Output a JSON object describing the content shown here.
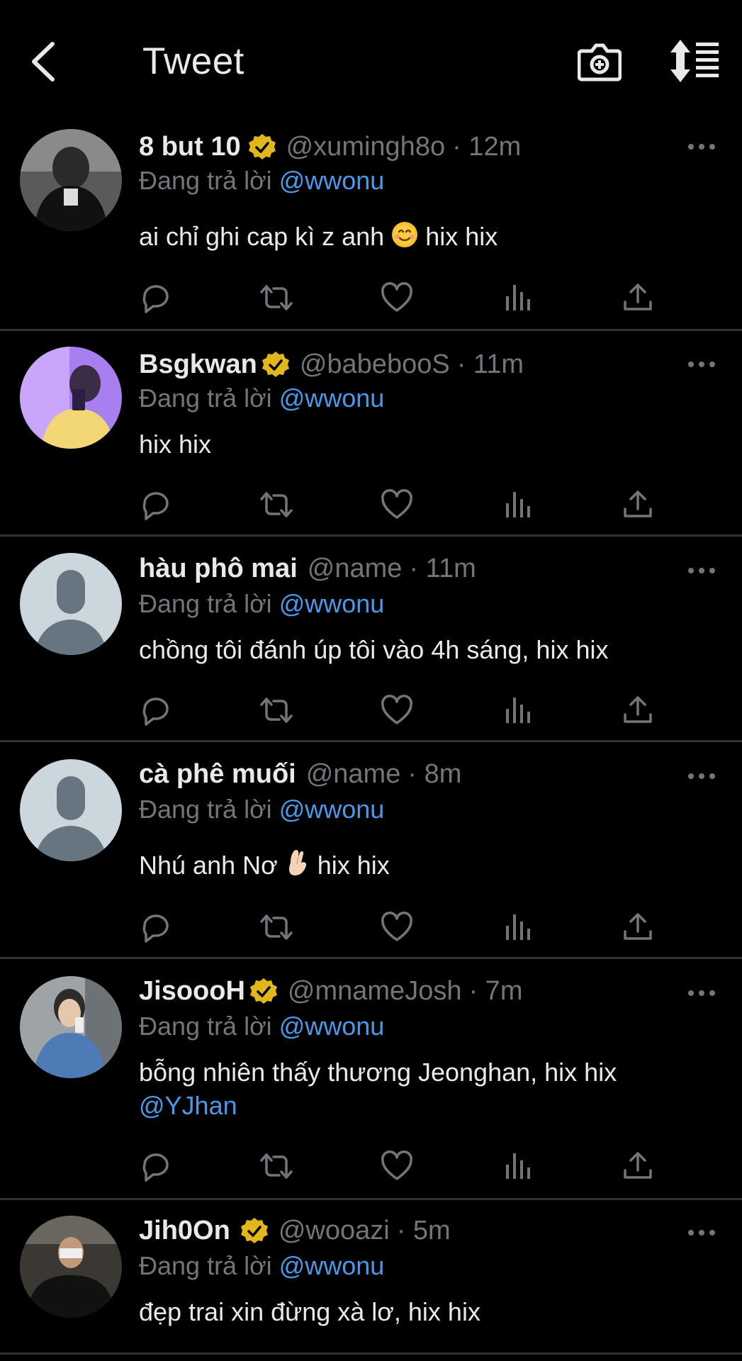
{
  "header": {
    "title": "Tweet"
  },
  "reply_prefix": "Đang trả lời",
  "tweets": [
    {
      "name": "8 but 10",
      "verified": true,
      "handle": "@xumingh8o",
      "time": "· 12m",
      "reply_to": "@wwonu",
      "text": "ai chỉ ghi cap kì z anh",
      "emoji": "smiling-face",
      "text_after": "hix hix",
      "avatar": "photo-bw"
    },
    {
      "name": "Bsgkwan",
      "verified": true,
      "handle": "@babebooS",
      "time": "· 11m",
      "reply_to": "@wwonu",
      "text": "hix hix",
      "avatar": "photo-purple"
    },
    {
      "name": "hàu phô mai",
      "verified": false,
      "handle": "@name",
      "time": "· 11m",
      "reply_to": "@wwonu",
      "text": "chồng tôi đánh úp tôi vào 4h sáng, hix hix",
      "avatar": "default"
    },
    {
      "name": "cà phê muối",
      "verified": false,
      "handle": "@name",
      "time": "· 8m",
      "reply_to": "@wwonu",
      "text": "Nhú anh Nơ",
      "emoji": "hand-pinch",
      "text_after": "hix hix",
      "avatar": "default"
    },
    {
      "name": "JisoooH",
      "verified": true,
      "handle": "@mnameJosh",
      "time": "· 7m",
      "reply_to": "@wwonu",
      "text": "bỗng nhiên thấy thương Jeonghan, hix hix",
      "text_line2": "@YJhan",
      "avatar": "photo-denim"
    },
    {
      "name": "Jih0On",
      "verified": true,
      "handle": "@wooazi",
      "time": "· 5m",
      "reply_to": "@wwonu",
      "text": "đẹp trai xin đừng xà lơ, hix hix",
      "avatar": "photo-dark"
    }
  ],
  "colors": {
    "background": "#000000",
    "text": "#e7e9ea",
    "secondary": "#71767b",
    "link": "#4a99e9",
    "verified": "#e2b719",
    "divider": "#2f3336"
  }
}
